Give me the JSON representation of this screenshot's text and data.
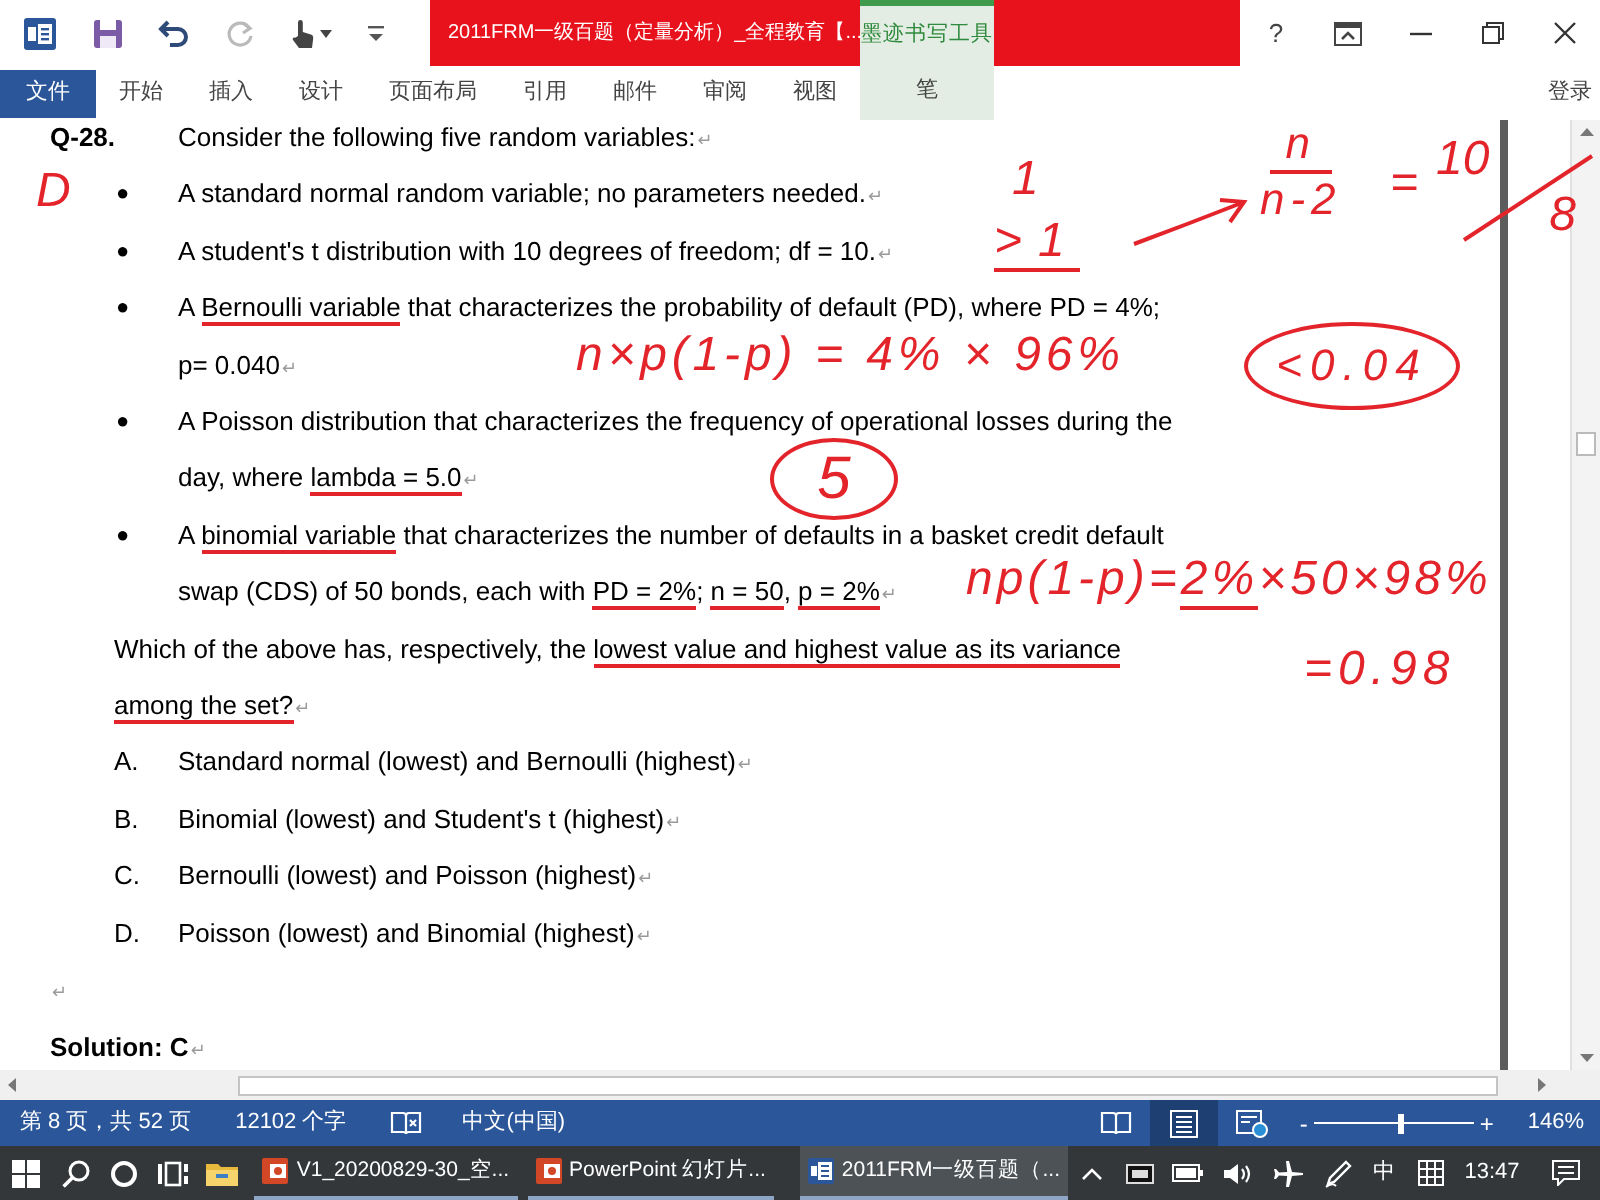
{
  "title_bar": {
    "quick_access": [
      {
        "kind": "app",
        "disabled": false
      },
      {
        "kind": "save",
        "disabled": false
      },
      {
        "kind": "undo",
        "disabled": false
      },
      {
        "kind": "redo",
        "disabled": true
      },
      {
        "kind": "touch",
        "disabled": false
      },
      {
        "kind": "customize",
        "disabled": false
      }
    ],
    "title": "2011FRM一级百题（定量分析）_全程教育【...",
    "contextual_group": "墨迹书写工具",
    "controls": [
      {
        "kind": "help",
        "label": "?"
      },
      {
        "kind": "ribbon_display"
      },
      {
        "kind": "minimize"
      },
      {
        "kind": "restore"
      },
      {
        "kind": "close"
      }
    ]
  },
  "ribbon": {
    "tabs": [
      {
        "kind": "file",
        "label": "文件"
      },
      {
        "kind": "tab",
        "label": "开始"
      },
      {
        "kind": "tab",
        "label": "插入"
      },
      {
        "kind": "tab",
        "label": "设计"
      },
      {
        "kind": "tab",
        "label": "页面布局"
      },
      {
        "kind": "tab",
        "label": "引用"
      },
      {
        "kind": "tab",
        "label": "邮件"
      },
      {
        "kind": "tab",
        "label": "审阅"
      },
      {
        "kind": "tab",
        "label": "视图"
      },
      {
        "kind": "contextual",
        "label": "笔"
      }
    ],
    "account": "登录"
  },
  "document": {
    "paragraphs": [
      {
        "kind": "question",
        "number": "Q-28.",
        "lines": [
          [
            {
              "text": "Consider the following five random variables:",
              "ink_underline": false
            }
          ]
        ],
        "mark": "↵"
      },
      {
        "kind": "bullet",
        "bullet": "●",
        "lines": [
          [
            {
              "text": "A standard normal random variable; no parameters needed.",
              "ink_underline": false
            }
          ]
        ],
        "mark": "↵"
      },
      {
        "kind": "bullet",
        "bullet": "●",
        "lines": [
          [
            {
              "text": "A student's t distribution with 10 degrees of freedom; df = 10.",
              "ink_underline": false
            }
          ]
        ],
        "mark": "↵"
      },
      {
        "kind": "bullet",
        "bullet": "●",
        "lines": [
          [
            {
              "text": "A ",
              "ink_underline": false
            },
            {
              "text": "Bernoulli variable",
              "ink_underline": true
            },
            {
              "text": " that characterizes the probability of default (PD), where PD = 4%;",
              "ink_underline": false
            }
          ],
          [
            {
              "text": "p= 0.040",
              "ink_underline": false
            }
          ]
        ],
        "mark": "↵"
      },
      {
        "kind": "bullet",
        "bullet": "●",
        "lines": [
          [
            {
              "text": "A Poisson distribution that characterizes the frequency of operational losses during the",
              "ink_underline": false
            }
          ],
          [
            {
              "text": "day, where ",
              "ink_underline": false
            },
            {
              "text": "lambda = 5.0",
              "ink_underline": true
            }
          ]
        ],
        "mark": "↵"
      },
      {
        "kind": "bullet",
        "bullet": "●",
        "lines": [
          [
            {
              "text": "A ",
              "ink_underline": false
            },
            {
              "text": "binomial variable",
              "ink_underline": true
            },
            {
              "text": " that characterizes the number of defaults in a basket credit default",
              "ink_underline": false
            }
          ],
          [
            {
              "text": "swap (CDS) of 50 bonds, each with ",
              "ink_underline": false
            },
            {
              "text": "PD = 2%",
              "ink_underline": true
            },
            {
              "text": "; ",
              "ink_underline": false
            },
            {
              "text": "n = 50",
              "ink_underline": true
            },
            {
              "text": ", ",
              "ink_underline": false
            },
            {
              "text": "p = 2%",
              "ink_underline": true
            }
          ]
        ],
        "mark": "↵"
      },
      {
        "kind": "plain",
        "lines": [
          [
            {
              "text": "Which of the above has, respectively, the ",
              "ink_underline": false
            },
            {
              "text": "lowest value and highest value as its variance",
              "ink_underline": true
            }
          ],
          [
            {
              "text": "among the set?",
              "ink_underline": true
            }
          ]
        ],
        "mark": "↵"
      },
      {
        "kind": "option",
        "label": "A.",
        "lines": [
          [
            {
              "text": "Standard normal (lowest) and Bernoulli (highest)",
              "ink_underline": false
            }
          ]
        ],
        "mark": "↵"
      },
      {
        "kind": "option",
        "label": "B.",
        "lines": [
          [
            {
              "text": "Binomial (lowest) and Student's t (highest)",
              "ink_underline": false
            }
          ]
        ],
        "mark": "↵"
      },
      {
        "kind": "option",
        "label": "C.",
        "lines": [
          [
            {
              "text": "Bernoulli (lowest) and Poisson (highest)",
              "ink_underline": false
            }
          ]
        ],
        "mark": "↵"
      },
      {
        "kind": "option",
        "label": "D.",
        "lines": [
          [
            {
              "text": "Poisson (lowest) and Binomial (highest)",
              "ink_underline": false
            }
          ]
        ],
        "mark": "↵"
      },
      {
        "kind": "empty",
        "mark": "↵"
      },
      {
        "kind": "solution",
        "lines": [
          [
            {
              "text": "Solution: C",
              "ink_underline": false
            }
          ]
        ],
        "mark": "↵"
      }
    ]
  },
  "ink": [
    {
      "kind": "text",
      "segments": [
        {
          "text": "D",
          "ink_underline": false
        }
      ]
    },
    {
      "kind": "text",
      "segments": [
        {
          "text": "1",
          "ink_underline": false
        }
      ]
    },
    {
      "kind": "text",
      "segments": [
        {
          "text": ">1",
          "ink_underline": true
        }
      ]
    },
    {
      "kind": "arrow"
    },
    {
      "kind": "fraction",
      "numerator": "n",
      "denominator": "n-2"
    },
    {
      "kind": "text",
      "segments": [
        {
          "text": "=",
          "ink_underline": false
        }
      ]
    },
    {
      "kind": "slash_fraction",
      "numerator": "10",
      "denominator": "8"
    },
    {
      "kind": "text",
      "segments": [
        {
          "text": "n×p(1-p) = 4% × 96%",
          "ink_underline": false
        }
      ]
    },
    {
      "kind": "circled",
      "segments": [
        {
          "text": "<0.04",
          "ink_underline": false
        }
      ]
    },
    {
      "kind": "circled",
      "segments": [
        {
          "text": "5",
          "ink_underline": false
        }
      ]
    },
    {
      "kind": "text",
      "segments": [
        {
          "text": "np(1-p)=",
          "ink_underline": false
        },
        {
          "text": "2%",
          "ink_underline": true
        },
        {
          "text": "×50×98%",
          "ink_underline": false
        }
      ]
    },
    {
      "kind": "text",
      "segments": [
        {
          "text": "=0.98",
          "ink_underline": false
        }
      ]
    }
  ],
  "status_bar": {
    "page_info": "第 8 页，共 52 页",
    "word_count": "12102 个字",
    "language": "中文(中国)",
    "views": [
      {
        "kind": "read",
        "selected": false
      },
      {
        "kind": "print",
        "selected": true
      },
      {
        "kind": "web",
        "selected": false
      }
    ],
    "zoom": {
      "out": "-",
      "in": "+",
      "level": 0.54,
      "reading": "146%"
    }
  },
  "taskbar": {
    "buttons": [
      {
        "kind": "start"
      },
      {
        "kind": "search"
      },
      {
        "kind": "cortana"
      },
      {
        "kind": "task_view"
      },
      {
        "kind": "explorer"
      }
    ],
    "apps": [
      {
        "kind": "presentation",
        "label": "V1_20200829-30_空...",
        "selected": false
      },
      {
        "kind": "presentation",
        "label": "PowerPoint 幻灯片...",
        "selected": false
      },
      {
        "kind": "document",
        "label": "2011FRM一级百题（...",
        "selected": true
      }
    ],
    "tray": [
      {
        "kind": "chevron"
      },
      {
        "kind": "screen"
      },
      {
        "kind": "battery"
      },
      {
        "kind": "volume"
      },
      {
        "kind": "airplane"
      },
      {
        "kind": "pen"
      },
      {
        "kind": "ime",
        "label": "中"
      },
      {
        "kind": "ime_mode"
      },
      {
        "kind": "clock",
        "label": "13:47"
      },
      {
        "kind": "notifications"
      }
    ]
  }
}
